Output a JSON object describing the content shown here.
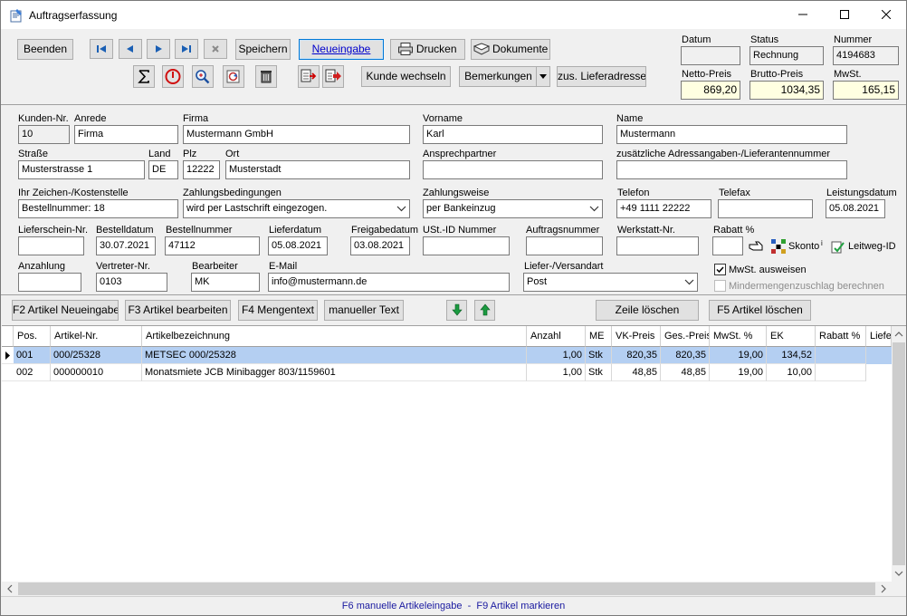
{
  "window": {
    "title": "Auftragserfassung"
  },
  "toolbar": {
    "beenden": "Beenden",
    "speichern": "Speichern",
    "neueingabe": "Neueingabe",
    "drucken": "Drucken",
    "dokumente": "Dokumente",
    "kunde_wechseln": "Kunde wechseln",
    "bemerkungen": "Bemerkungen",
    "lieferadresse": "zus. Lieferadresse"
  },
  "summary": {
    "datum_label": "Datum",
    "datum": "",
    "status_label": "Status",
    "status": "Rechnung",
    "nummer_label": "Nummer",
    "nummer": "4194683",
    "netto_label": "Netto-Preis",
    "netto": "869,20",
    "brutto_label": "Brutto-Preis",
    "brutto": "1034,35",
    "mwst_label": "MwSt.",
    "mwst": "165,15"
  },
  "customer": {
    "kundennr_label": "Kunden-Nr.",
    "kundennr": "10",
    "anrede_label": "Anrede",
    "anrede": "Firma",
    "firma_label": "Firma",
    "firma": "Mustermann GmbH",
    "vorname_label": "Vorname",
    "vorname": "Karl",
    "name_label": "Name",
    "name": "Mustermann",
    "strasse_label": "Straße",
    "strasse": "Musterstrasse 1",
    "land_label": "Land",
    "land": "DE",
    "plz_label": "Plz",
    "plz": "12222",
    "ort_label": "Ort",
    "ort": "Musterstadt",
    "ansprech_label": "Ansprechpartner",
    "ansprech": "",
    "zusatz_label": "zusätzliche Adressangaben-/Lieferantennummer",
    "zusatz": "",
    "zeichen_label": "Ihr Zeichen-/Kostenstelle",
    "zeichen": "Bestellnummer: 18",
    "zahlbed_label": "Zahlungsbedingungen",
    "zahlbed": "wird per Lastschrift eingezogen.",
    "zahlweise_label": "Zahlungsweise",
    "zahlweise": "per Bankeinzug",
    "telefon_label": "Telefon",
    "telefon": "+49 1111 22222",
    "telefax_label": "Telefax",
    "telefax": "",
    "leistung_label": "Leistungsdatum",
    "leistung": "05.08.2021",
    "lieferschein_label": "Lieferschein-Nr.",
    "lieferschein": "",
    "bestelldatum_label": "Bestelldatum",
    "bestelldatum": "30.07.2021",
    "bestellnr_label": "Bestellnummer",
    "bestellnr": "47112",
    "lieferdatum_label": "Lieferdatum",
    "lieferdatum": "05.08.2021",
    "freigabe_label": "Freigabedatum",
    "freigabe": "03.08.2021",
    "ustid_label": "USt.-ID Nummer",
    "ustid": "",
    "auftragsnr_label": "Auftragsnummer",
    "auftragsnr": "",
    "werkstatt_label": "Werkstatt-Nr.",
    "werkstatt": "",
    "rabatt_label": "Rabatt %",
    "rabatt": "",
    "skonto_label": "Skonto",
    "leitweg_label": "Leitweg-ID",
    "anzahlung_label": "Anzahlung",
    "anzahlung": "",
    "vertreter_label": "Vertreter-Nr.",
    "vertreter": "0103",
    "bearbeiter_label": "Bearbeiter",
    "bearbeiter": "MK",
    "email_label": "E-Mail",
    "email": "info@mustermann.de",
    "versand_label": "Liefer-/Versandart",
    "versand": "Post",
    "mwst_ausweisen": "MwSt. ausweisen",
    "mindermengen": "Mindermengenzuschlag berechnen"
  },
  "actions": {
    "f2": "F2 Artikel Neueingabe",
    "f3": "F3 Artikel bearbeiten",
    "f4": "F4 Mengentext",
    "manuell": "manueller Text",
    "zeile": "Zeile löschen",
    "f5": "F5 Artikel löschen"
  },
  "grid": {
    "columns": [
      "Pos.",
      "Artikel-Nr.",
      "Artikelbezeichnung",
      "Anzahl",
      "ME",
      "VK-Preis",
      "Ges.-Preis",
      "MwSt. %",
      "EK",
      "Rabatt %",
      "Liefe"
    ],
    "rows": [
      [
        "001",
        "000/25328",
        "METSEC 000/25328",
        "1,00",
        "Stk",
        "820,35",
        "820,35",
        "19,00",
        "134,52",
        ""
      ],
      [
        "002",
        "000000010",
        "Monatsmiete JCB Minibagger 803/1159601",
        "1,00",
        "Stk",
        "48,85",
        "48,85",
        "19,00",
        "10,00",
        ""
      ]
    ]
  },
  "status": {
    "hint": "F6 manuelle Artikeleingabe  -  F9 Artikel markieren"
  },
  "colors": {
    "accent": "#0078d7",
    "selection": "#b4cff2",
    "yellow_field": "#ffffe1"
  }
}
